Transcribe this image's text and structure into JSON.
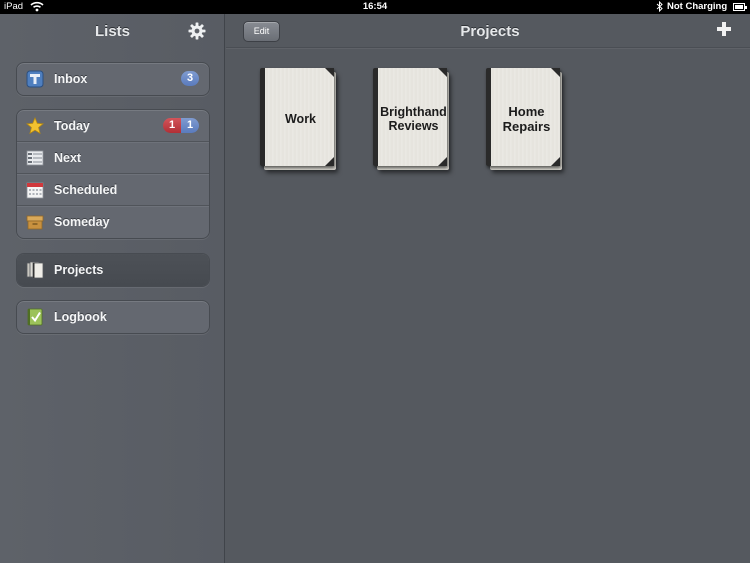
{
  "status_bar": {
    "carrier": "iPad",
    "time": "16:54",
    "charging_text": "Not Charging"
  },
  "sidebar": {
    "title": "Lists",
    "inbox": {
      "label": "Inbox",
      "count": "3"
    },
    "focus": [
      {
        "label": "Today",
        "icon": "star-icon",
        "due_count": "1",
        "count": "1"
      },
      {
        "label": "Next",
        "icon": "next-list-icon"
      },
      {
        "label": "Scheduled",
        "icon": "calendar-icon"
      },
      {
        "label": "Someday",
        "icon": "box-icon"
      }
    ],
    "projects": {
      "label": "Projects",
      "icon": "projects-icon"
    },
    "logbook": {
      "label": "Logbook",
      "icon": "logbook-icon"
    }
  },
  "main": {
    "edit_label": "Edit",
    "title": "Projects",
    "projects": [
      {
        "name": "Work"
      },
      {
        "name": "Brighthand\nReviews"
      },
      {
        "name": "Home\nRepairs"
      }
    ]
  },
  "colors": {
    "background": "#55595f",
    "badge_blue": "#5a7bbd",
    "badge_red": "#b12f36"
  }
}
